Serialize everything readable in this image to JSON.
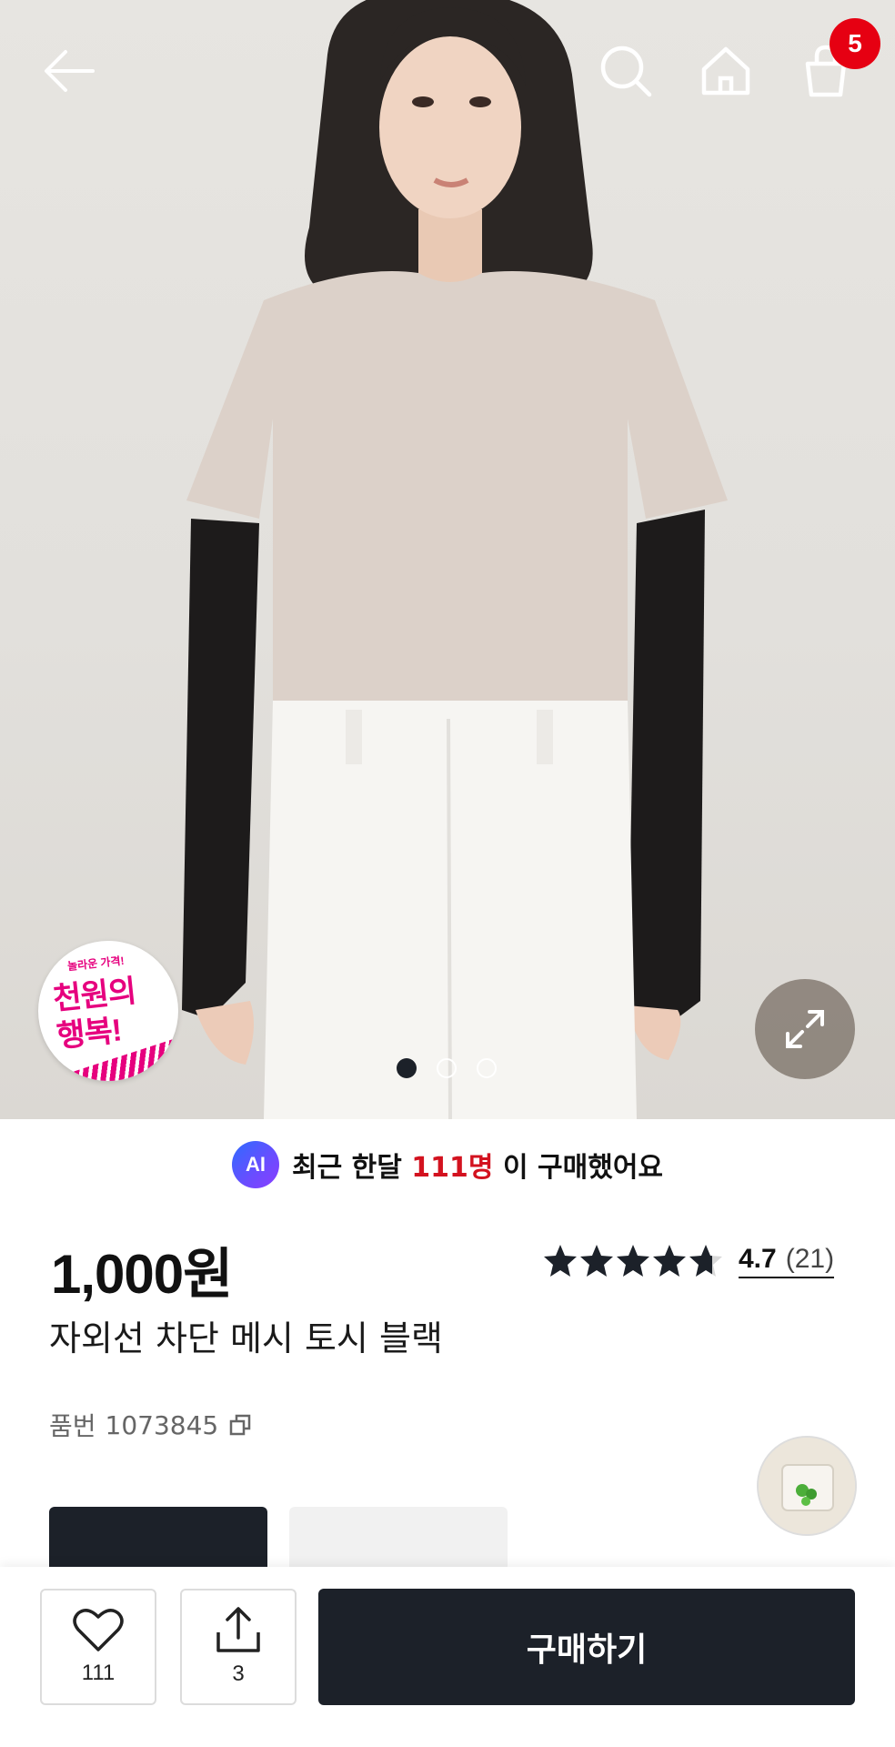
{
  "header": {
    "cart_count": "5"
  },
  "hero": {
    "promo_small": "놀라운 가격!",
    "promo_line1": "천원의",
    "promo_line2": "행복!",
    "pagination_total": 3,
    "pagination_active": 1
  },
  "ai_banner": {
    "badge": "AI",
    "prefix": "최근 한달",
    "count": "111명",
    "suffix": "이 구매했어요"
  },
  "product": {
    "price": "1,000원",
    "name": "자외선 차단 메시 토시 블랙",
    "sku_label": "품번",
    "sku_number": "1073845"
  },
  "rating": {
    "stars": 4.7,
    "value": "4.7",
    "count": "(21)"
  },
  "bottom_bar": {
    "like_count": "111",
    "share_count": "3",
    "buy_label": "구매하기"
  },
  "colors": {
    "accent_red": "#e60012",
    "dark": "#1c2129",
    "ai_count_red": "#d3121f"
  }
}
